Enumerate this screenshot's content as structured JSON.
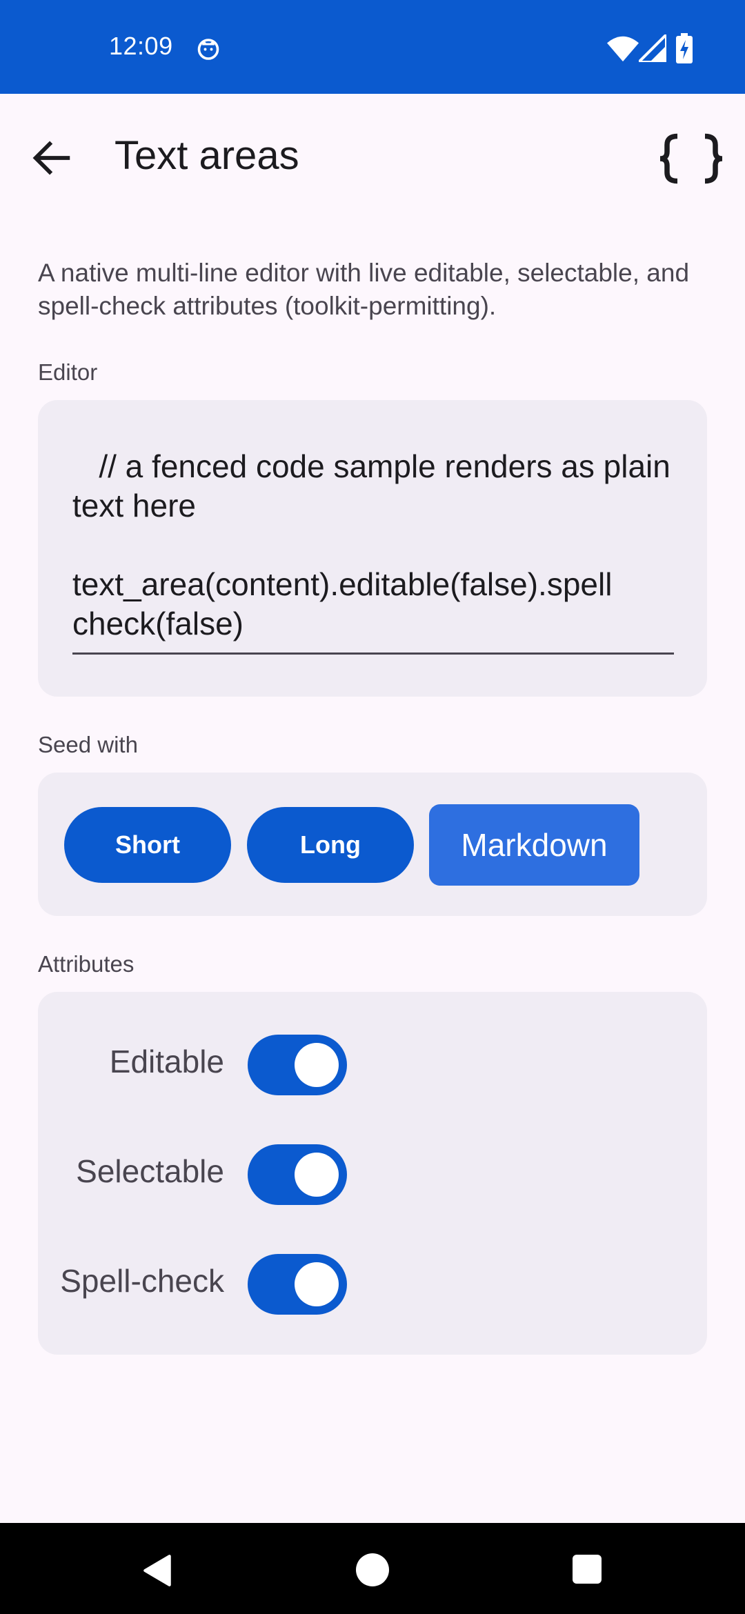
{
  "status_bar": {
    "time": "12:09",
    "background": "#0b5acf"
  },
  "app_bar": {
    "title": "Text areas",
    "back_icon": "arrow-back-icon",
    "action_icon": "code-braces-icon"
  },
  "description": "A native multi-line editor with live editable, selectable, and spell-check attributes (toolkit-permitting).",
  "editor": {
    "label": "Editor",
    "content": "   // a fenced code sample renders as plain text here\n\ntext_area(content).editable(false).spell check(false)"
  },
  "seed": {
    "label": "Seed with",
    "buttons": [
      {
        "label": "Short",
        "selected": false
      },
      {
        "label": "Long",
        "selected": false
      },
      {
        "label": "Markdown",
        "selected": true
      }
    ]
  },
  "attributes": {
    "label": "Attributes",
    "items": [
      {
        "label": "Editable",
        "on": true
      },
      {
        "label": "Selectable",
        "on": true
      },
      {
        "label": "Spell-check",
        "on": true
      }
    ]
  },
  "colors": {
    "accent": "#0b5acf",
    "accent_selected": "#2e6fe0",
    "card": "#f0ecf4",
    "background": "#fdf7fd"
  }
}
